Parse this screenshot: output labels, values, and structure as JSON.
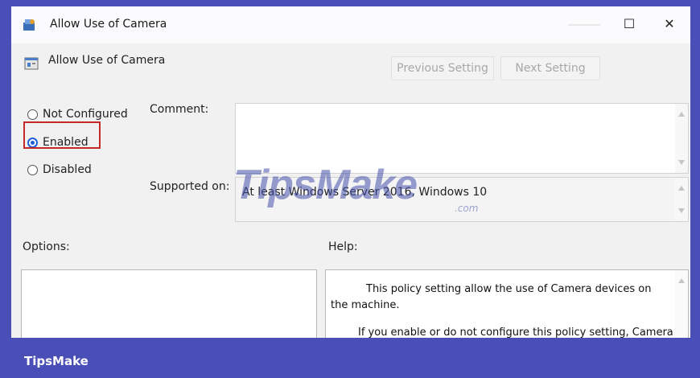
{
  "window": {
    "title": "Allow Use of Camera",
    "maximize_glyph": "☐",
    "close_glyph": "✕"
  },
  "header": {
    "title": "Allow Use of Camera",
    "prev_label": "Previous Setting",
    "next_label": "Next Setting"
  },
  "state": {
    "options": [
      "Not Configured",
      "Enabled",
      "Disabled"
    ],
    "selected": "Enabled"
  },
  "comment": {
    "label": "Comment:",
    "value": ""
  },
  "supported": {
    "label": "Supported on:",
    "value": "At least Windows Server 2016, Windows 10"
  },
  "options_panel": {
    "label": "Options:"
  },
  "help_panel": {
    "label": "Help:",
    "para1": "This policy setting allow the use of Camera devices on the machine.",
    "para2": "If you enable or do not configure this policy setting, Camera"
  },
  "watermark": {
    "text": "TipsMake",
    "suffix": ".com"
  },
  "footer": {
    "brand": "TipsMake"
  },
  "colors": {
    "accent": "#1d5fd6",
    "highlight_box": "#c62828",
    "frame_bg": "#4a4fb8"
  },
  "icons": {
    "window": "policy-icon",
    "header": "setting-icon"
  }
}
